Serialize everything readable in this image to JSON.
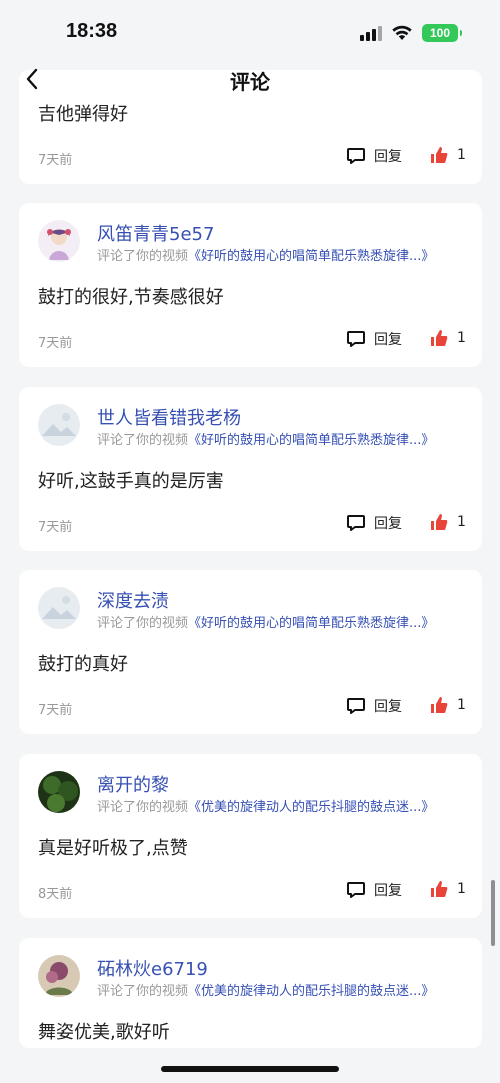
{
  "status_bar": {
    "time": "18:38",
    "battery": "100"
  },
  "nav": {
    "title": "评论"
  },
  "labels": {
    "reply": "回复",
    "meta_prefix": "评论了你的视频"
  },
  "comments": [
    {
      "user": "",
      "video": "",
      "text": "吉他弹得好",
      "time": "7天前",
      "likes": "1"
    },
    {
      "user": "风笛青青5e57",
      "video": "《好听的鼓用心的唱简单配乐熟悉旋律...》",
      "text": "鼓打的很好,节奏感很好",
      "time": "7天前",
      "likes": "1"
    },
    {
      "user": "世人皆看错我老杨",
      "video": "《好听的鼓用心的唱简单配乐熟悉旋律...》",
      "text": "好听,这鼓手真的是厉害",
      "time": "7天前",
      "likes": "1"
    },
    {
      "user": "深度去渍",
      "video": "《好听的鼓用心的唱简单配乐熟悉旋律...》",
      "text": "鼓打的真好",
      "time": "7天前",
      "likes": "1"
    },
    {
      "user": "离开的黎",
      "video": "《优美的旋律动人的配乐抖腿的鼓点迷...》",
      "text": "真是好听极了,点赞",
      "time": "8天前",
      "likes": "1"
    },
    {
      "user": "砳林�englishe6719",
      "video": "《优美的旋律动人的配乐抖腿的鼓点迷...》",
      "text": "舞姿优美,歌好听",
      "time": "",
      "likes": ""
    }
  ],
  "colors": {
    "accent": "#3650b3",
    "like": "#e8443a",
    "battery": "#34c759"
  }
}
